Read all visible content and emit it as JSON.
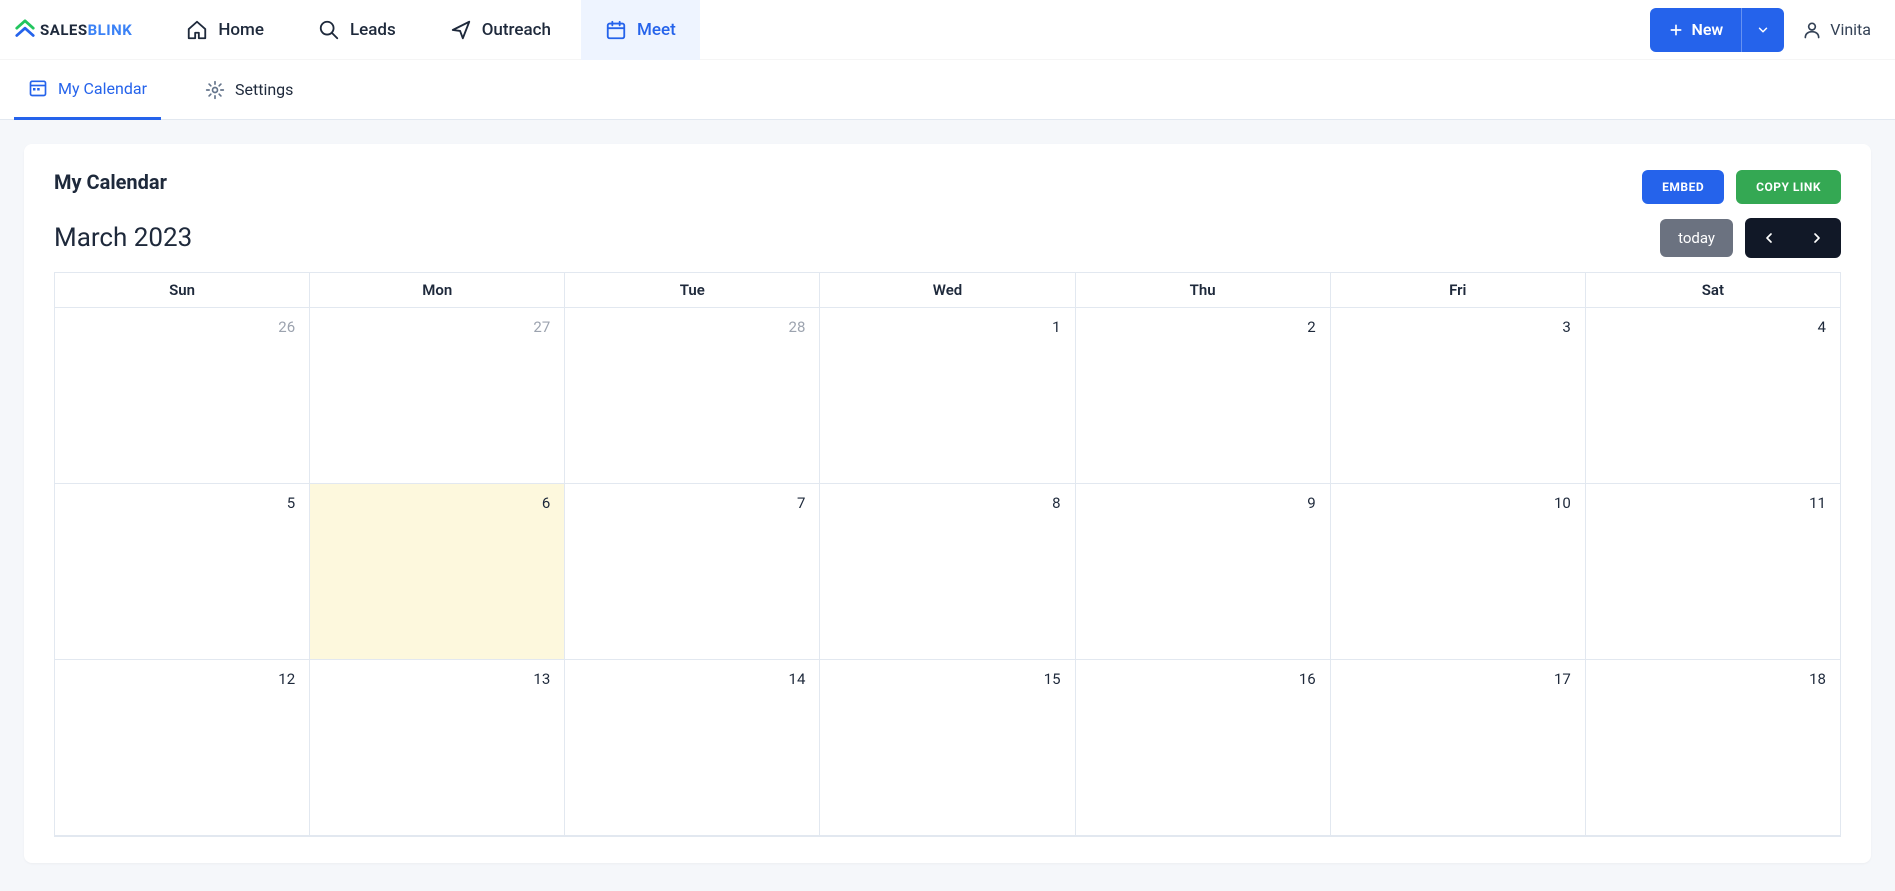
{
  "logo": {
    "text1": "SALES",
    "text2": "BLINK"
  },
  "nav": {
    "home": "Home",
    "leads": "Leads",
    "outreach": "Outreach",
    "meet": "Meet"
  },
  "new_button": {
    "label": "New"
  },
  "user": {
    "name": "Vinita"
  },
  "subnav": {
    "my_calendar": "My Calendar",
    "settings": "Settings"
  },
  "card": {
    "title": "My Calendar",
    "embed": "EMBED",
    "copy_link": "COPY LINK"
  },
  "calendar": {
    "month": "March 2023",
    "today": "today",
    "headers": [
      "Sun",
      "Mon",
      "Tue",
      "Wed",
      "Thu",
      "Fri",
      "Sat"
    ],
    "rows": [
      [
        {
          "n": "26",
          "other": true
        },
        {
          "n": "27",
          "other": true
        },
        {
          "n": "28",
          "other": true
        },
        {
          "n": "1"
        },
        {
          "n": "2"
        },
        {
          "n": "3"
        },
        {
          "n": "4"
        }
      ],
      [
        {
          "n": "5"
        },
        {
          "n": "6",
          "today": true
        },
        {
          "n": "7"
        },
        {
          "n": "8"
        },
        {
          "n": "9"
        },
        {
          "n": "10"
        },
        {
          "n": "11"
        }
      ],
      [
        {
          "n": "12"
        },
        {
          "n": "13"
        },
        {
          "n": "14"
        },
        {
          "n": "15"
        },
        {
          "n": "16"
        },
        {
          "n": "17"
        },
        {
          "n": "18"
        }
      ]
    ]
  }
}
